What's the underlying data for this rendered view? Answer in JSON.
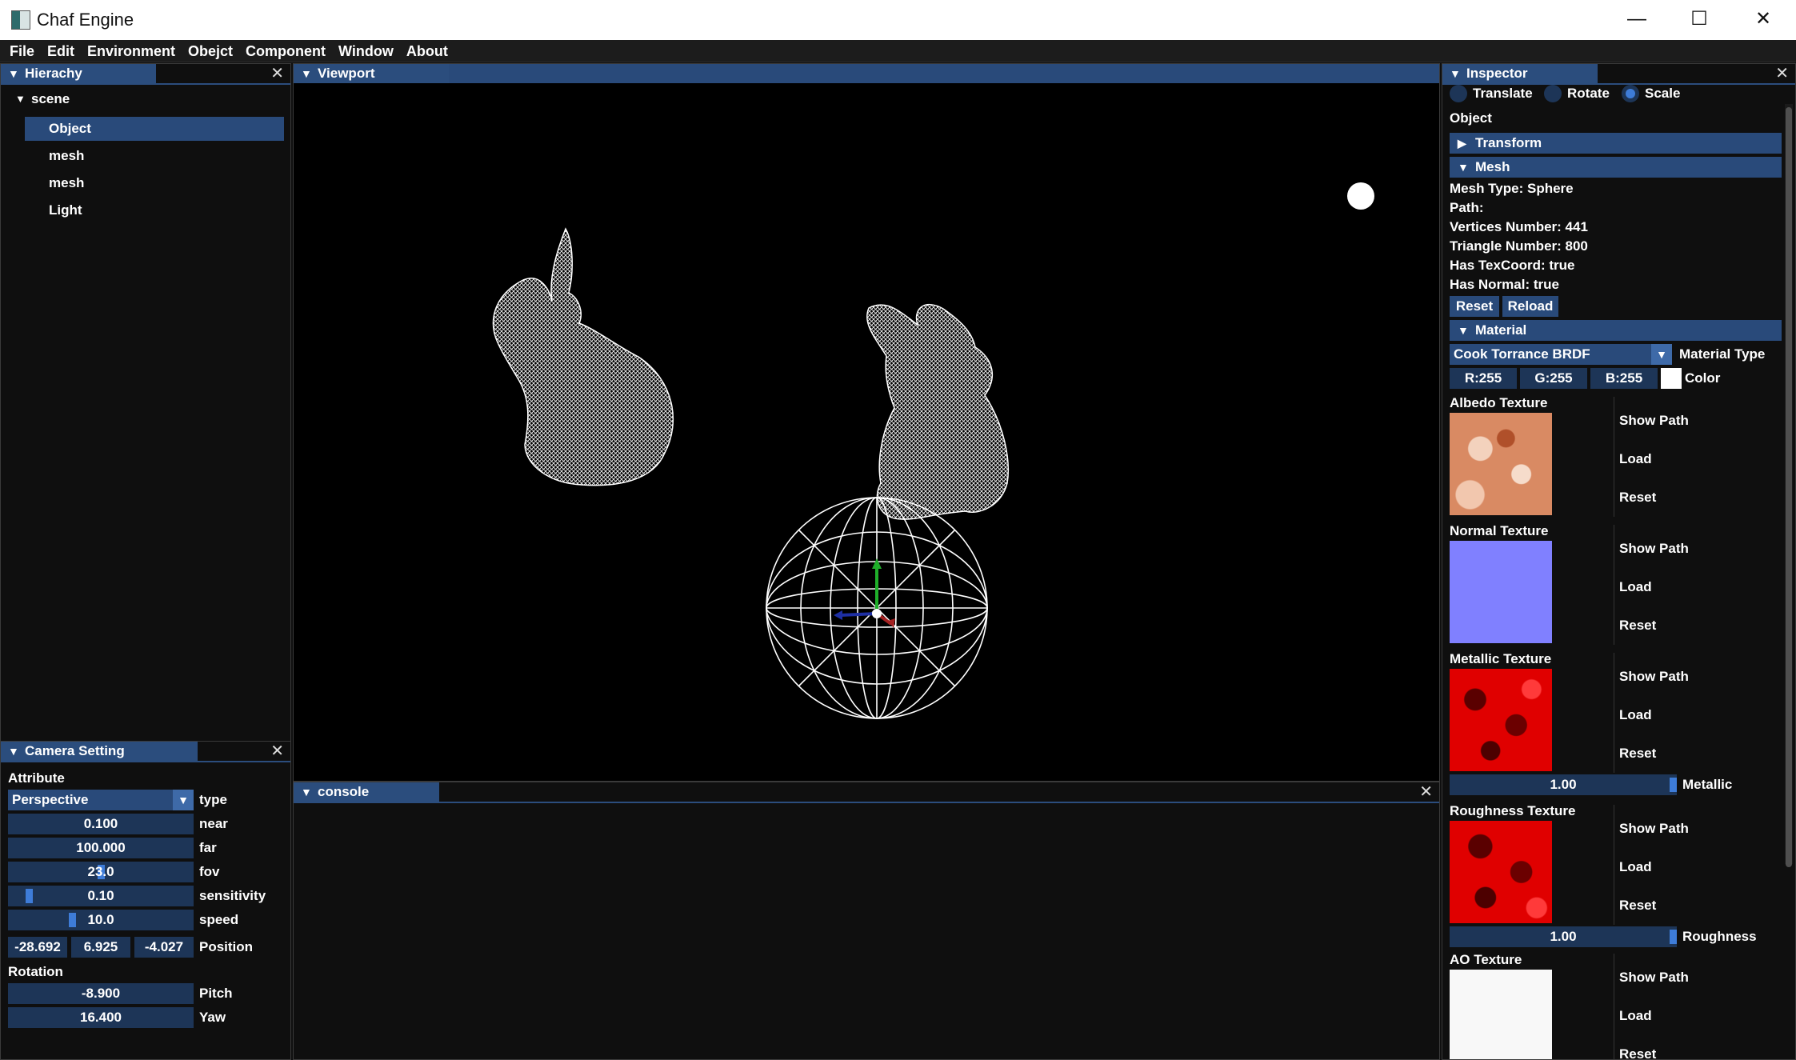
{
  "window": {
    "title": "Chaf Engine",
    "minimize": "—",
    "maximize": "☐",
    "close": "✕"
  },
  "menu": [
    "File",
    "Edit",
    "Environment",
    "Obejct",
    "Component",
    "Window",
    "About"
  ],
  "hierarchy": {
    "tab": "Hierachy",
    "root": "scene",
    "items": [
      "Object",
      "mesh",
      "mesh",
      "Light"
    ],
    "selected_index": 0
  },
  "camera": {
    "tab": "Camera Setting",
    "attribute_label": "Attribute",
    "type_value": "Perspective",
    "type_label": "type",
    "near": {
      "value": "0.100",
      "label": "near"
    },
    "far": {
      "value": "100.000",
      "label": "far"
    },
    "fov": {
      "value": "23.0",
      "label": "fov",
      "level": 0.5
    },
    "sensitivity": {
      "value": "0.10",
      "label": "sensitivity",
      "level": 0.1
    },
    "speed": {
      "value": "10.0",
      "label": "speed",
      "level": 0.34
    },
    "position": {
      "x": "-28.692",
      "y": "6.925",
      "z": "-4.027",
      "label": "Position"
    },
    "rotation_label": "Rotation",
    "pitch": {
      "value": "-8.900",
      "label": "Pitch"
    },
    "yaw": {
      "value": "16.400",
      "label": "Yaw"
    }
  },
  "viewport": {
    "tab": "Viewport",
    "background": "#000000",
    "wire_color": "#ffffff"
  },
  "console": {
    "tab": "console"
  },
  "inspector": {
    "tab": "Inspector",
    "gizmo_modes": [
      "Translate",
      "Rotate",
      "Scale"
    ],
    "gizmo_selected": "Scale",
    "object_label": "Object",
    "transform_header": "Transform",
    "mesh_header": "Mesh",
    "mesh_info": [
      "Mesh Type: Sphere",
      "Path:",
      "Vertices Number: 441",
      "Triangle Number: 800",
      "Has TexCoord: true",
      "Has Normal: true"
    ],
    "reset_label": "Reset",
    "reload_label": "Reload",
    "material_header": "Material",
    "material_type_value": "Cook Torrance BRDF",
    "material_type_label": "Material Type",
    "color_r": "R:255",
    "color_g": "G:255",
    "color_b": "B:255",
    "color_label": "Color",
    "textures": [
      {
        "title": "Albedo Texture",
        "show": "Show Path",
        "load": "Load",
        "reset": "Reset"
      },
      {
        "title": "Normal Texture",
        "show": "Show Path",
        "load": "Load",
        "reset": "Reset"
      },
      {
        "title": "Metallic Texture",
        "show": "Show Path",
        "load": "Load",
        "reset": "Reset"
      },
      {
        "title": "Roughness Texture",
        "show": "Show Path",
        "load": "Load",
        "reset": "Reset"
      },
      {
        "title": "AO Texture",
        "show": "Show Path",
        "load": "Load",
        "reset": "Reset"
      }
    ],
    "metallic": {
      "value": "1.00",
      "label": "Metallic",
      "level": 1.0
    },
    "roughness": {
      "value": "1.00",
      "label": "Roughness",
      "level": 1.0
    },
    "colors": {
      "accent": "#294a7a",
      "field": "#1d3557",
      "knob": "#3e7cd8"
    }
  }
}
